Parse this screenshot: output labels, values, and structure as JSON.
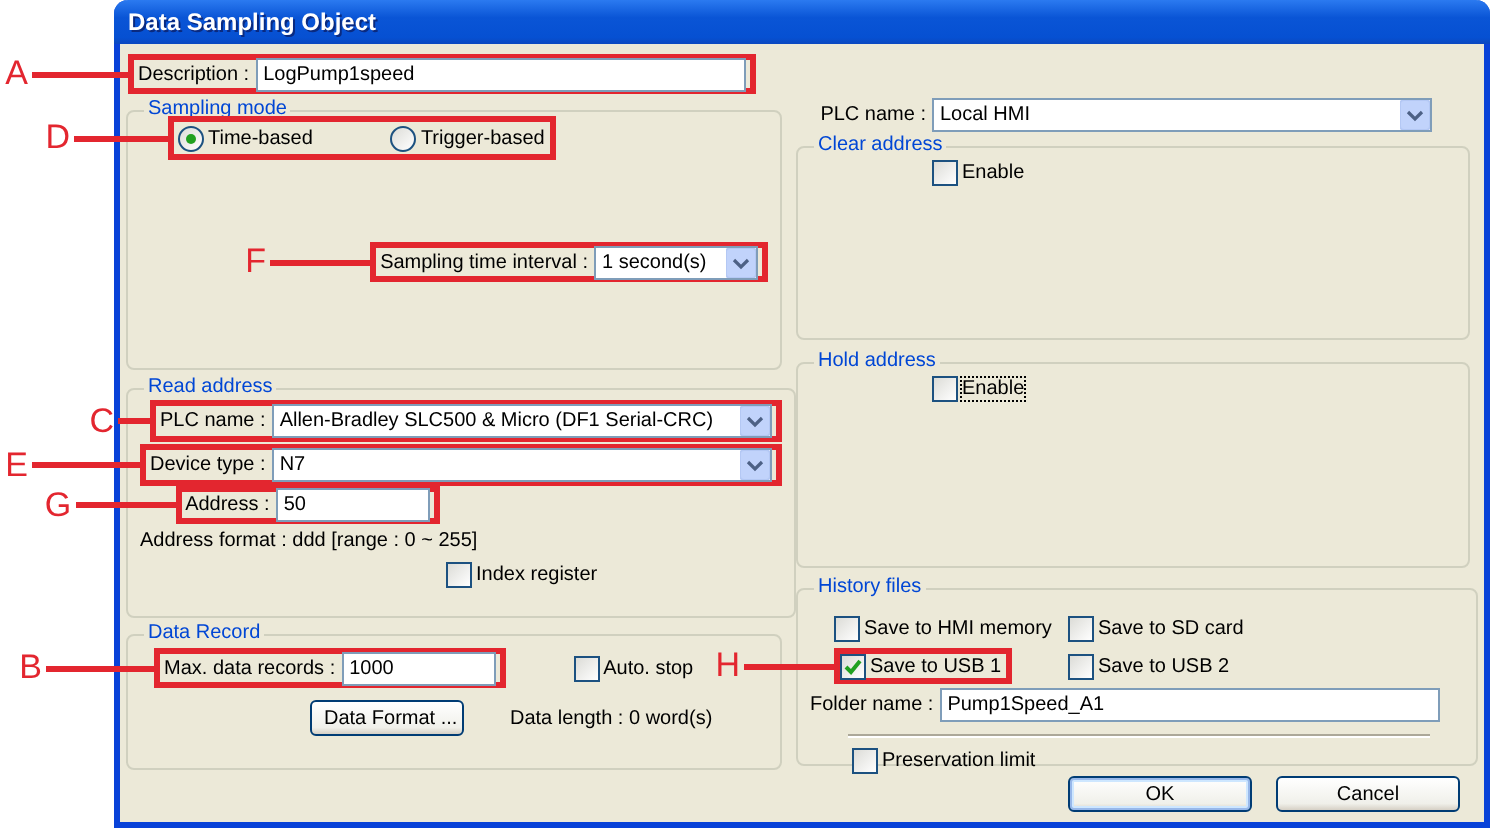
{
  "window": {
    "title": "Data Sampling Object"
  },
  "description": {
    "label": "Description :",
    "value": "LogPump1speed",
    "callout": "A"
  },
  "sampling_mode": {
    "title": "Sampling mode",
    "callout": "D",
    "options": [
      {
        "label": "Time-based",
        "selected": true
      },
      {
        "label": "Trigger-based",
        "selected": false
      }
    ],
    "interval": {
      "label": "Sampling time interval  :",
      "value": "1 second(s)",
      "callout": "F"
    }
  },
  "read_address": {
    "title": "Read address",
    "plc_name": {
      "label": "PLC name :",
      "value": "Allen-Bradley SLC500 & Micro (DF1 Serial-CRC)",
      "callout": "C"
    },
    "device_type": {
      "label": "Device type :",
      "value": "N7",
      "callout": "E"
    },
    "address": {
      "label": "Address :",
      "value": "50",
      "callout": "G"
    },
    "address_format": "Address format : ddd [range : 0 ~ 255]",
    "index_register": {
      "label": "Index register",
      "checked": false
    }
  },
  "data_record": {
    "title": "Data Record",
    "max_records": {
      "label": "Max. data records :",
      "value": "1000",
      "callout": "B"
    },
    "auto_stop": {
      "label": "Auto. stop",
      "checked": false
    },
    "format_button": "Data Format ...",
    "data_length": "Data length :  0 word(s)"
  },
  "plc_name": {
    "label": "PLC name :",
    "value": "Local HMI"
  },
  "clear_address": {
    "title": "Clear address",
    "enable": {
      "label": "Enable",
      "checked": false,
      "focused": false
    }
  },
  "hold_address": {
    "title": "Hold address",
    "enable": {
      "label": "Enable",
      "checked": false,
      "focused": true
    }
  },
  "history_files": {
    "title": "History files",
    "options": [
      {
        "label": "Save to HMI memory",
        "checked": false
      },
      {
        "label": "Save to SD card",
        "checked": false
      },
      {
        "label": "Save to USB 1",
        "checked": true,
        "callout": "H"
      },
      {
        "label": "Save to USB 2",
        "checked": false
      }
    ],
    "folder": {
      "label": "Folder name :",
      "value": "Pump1Speed_A1"
    },
    "preservation_limit": {
      "label": "Preservation limit",
      "checked": false
    }
  },
  "buttons": [
    {
      "label": "OK",
      "default": true
    },
    {
      "label": "Cancel",
      "default": false
    }
  ]
}
